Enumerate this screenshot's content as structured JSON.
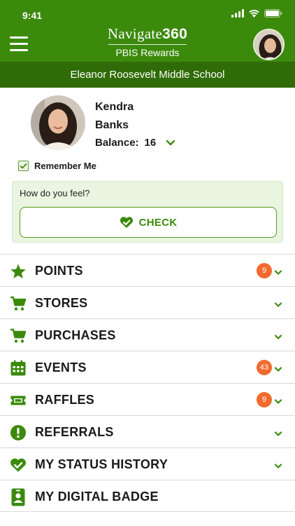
{
  "status_bar": {
    "time": "9:41"
  },
  "header": {
    "brand_text": "Navigate",
    "brand_number": "360",
    "subtitle": "PBIS Rewards",
    "menu_icon": "hamburger-icon"
  },
  "school": {
    "name": "Eleanor Roosevelt Middle School"
  },
  "profile": {
    "first_name": "Kendra",
    "last_name": "Banks",
    "balance_label": "Balance:",
    "balance_value": "16"
  },
  "remember_me": {
    "label": "Remember Me",
    "checked": true
  },
  "feelings": {
    "prompt": "How do you feel?",
    "button_label": "CHECK",
    "button_icon": "heart-check-icon"
  },
  "menu": [
    {
      "label": "POINTS",
      "icon": "star-icon",
      "badge": "9",
      "chevron": true
    },
    {
      "label": "STORES",
      "icon": "cart-icon",
      "badge": "",
      "chevron": true
    },
    {
      "label": "PURCHASES",
      "icon": "cart-icon",
      "badge": "",
      "chevron": true
    },
    {
      "label": "EVENTS",
      "icon": "calendar-icon",
      "badge": "43",
      "chevron": true
    },
    {
      "label": "RAFFLES",
      "icon": "ticket-icon",
      "badge": "9",
      "chevron": true
    },
    {
      "label": "REFERRALS",
      "icon": "exclamation-icon",
      "badge": "",
      "chevron": true
    },
    {
      "label": "MY STATUS HISTORY",
      "icon": "heart-check-icon",
      "badge": "",
      "chevron": true
    },
    {
      "label": "MY DIGITAL BADGE",
      "icon": "id-badge-icon",
      "badge": "",
      "chevron": false
    }
  ],
  "colors": {
    "primary": "#3b8a0c",
    "dark": "#2f6b07",
    "badge": "#f26a2e",
    "card_bg": "#eaf5e1"
  }
}
